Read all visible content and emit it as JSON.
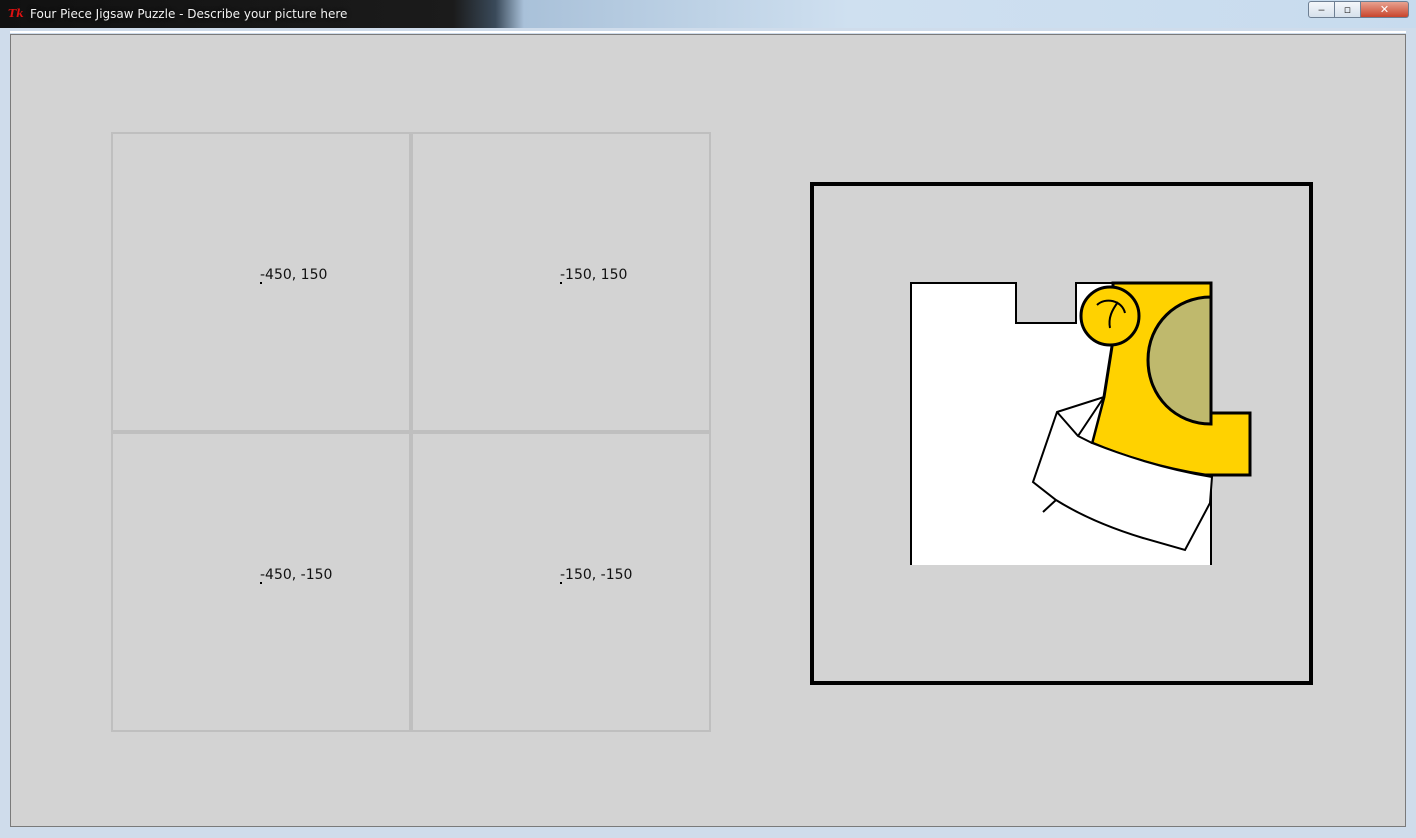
{
  "window": {
    "title": "Four Piece Jigsaw Puzzle - Describe your picture here",
    "icon": "tk-feather-icon",
    "minimize_label": "‒",
    "maximize_label": "▫",
    "close_label": "✕"
  },
  "grid": {
    "cells": [
      {
        "label": "-450, 150"
      },
      {
        "label": "-150, 150"
      },
      {
        "label": "-450, -150"
      },
      {
        "label": "-150, -150"
      }
    ]
  },
  "colors": {
    "canvas_bg": "#d3d3d3",
    "grid_line": "#bfbfbf",
    "piece_yellow": "#ffd200",
    "piece_olive": "#bfb96d",
    "piece_white": "#ffffff",
    "frame_border": "#000000"
  }
}
